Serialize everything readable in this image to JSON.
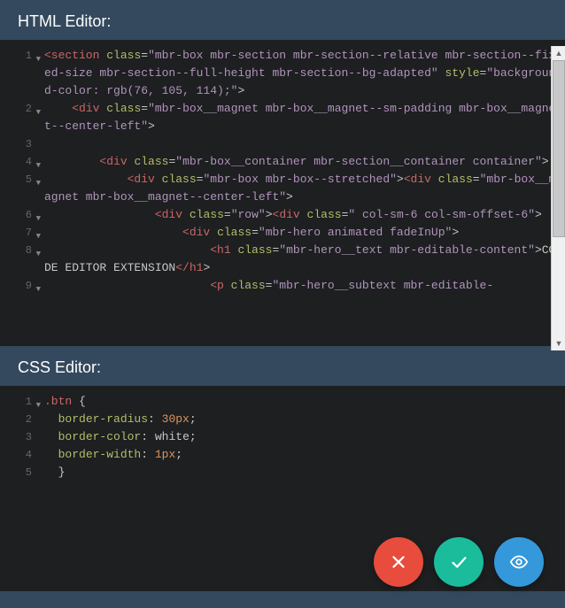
{
  "headers": {
    "html": "HTML Editor:",
    "css": "CSS Editor:"
  },
  "html_lines": [
    {
      "n": "1",
      "fold": true,
      "tokens": [
        [
          "tag",
          "<section"
        ],
        [
          "text",
          " "
        ],
        [
          "attr",
          "class"
        ],
        [
          "eq",
          "="
        ],
        [
          "str",
          "\"mbr-box mbr-section mbr-section--relative mbr-section--fixed-size mbr-section--full-height mbr-section--bg-adapted\""
        ],
        [
          "text",
          " "
        ],
        [
          "attr",
          "style"
        ],
        [
          "eq",
          "="
        ],
        [
          "str",
          "\"background-color: rgb(76, 105, 114);\""
        ],
        [
          "bracket",
          ">"
        ]
      ]
    },
    {
      "n": "2",
      "fold": true,
      "indent": 2,
      "tokens": [
        [
          "tag",
          "<div"
        ],
        [
          "text",
          " "
        ],
        [
          "attr",
          "class"
        ],
        [
          "eq",
          "="
        ],
        [
          "str",
          "\"mbr-box__magnet mbr-box__magnet--sm-padding mbr-box__magnet--center-left\""
        ],
        [
          "bracket",
          ">"
        ]
      ]
    },
    {
      "n": "3",
      "fold": false,
      "tokens": []
    },
    {
      "n": "4",
      "fold": true,
      "indent": 4,
      "tokens": [
        [
          "tag",
          "<div"
        ],
        [
          "text",
          " "
        ],
        [
          "attr",
          "class"
        ],
        [
          "eq",
          "="
        ],
        [
          "str",
          "\"mbr-box__container mbr-section__container container\""
        ],
        [
          "bracket",
          ">"
        ]
      ]
    },
    {
      "n": "5",
      "fold": true,
      "indent": 6,
      "tokens": [
        [
          "tag",
          "<div"
        ],
        [
          "text",
          " "
        ],
        [
          "attr",
          "class"
        ],
        [
          "eq",
          "="
        ],
        [
          "str",
          "\"mbr-box mbr-box--stretched\""
        ],
        [
          "bracket",
          ">"
        ],
        [
          "tag",
          "<div"
        ],
        [
          "text",
          " "
        ],
        [
          "attr",
          "class"
        ],
        [
          "eq",
          "="
        ],
        [
          "str",
          "\"mbr-box__magnet mbr-box__magnet--center-left\""
        ],
        [
          "bracket",
          ">"
        ]
      ]
    },
    {
      "n": "6",
      "fold": true,
      "indent": 8,
      "tokens": [
        [
          "tag",
          "<div"
        ],
        [
          "text",
          " "
        ],
        [
          "attr",
          "class"
        ],
        [
          "eq",
          "="
        ],
        [
          "str",
          "\"row\""
        ],
        [
          "bracket",
          ">"
        ],
        [
          "tag",
          "<div"
        ],
        [
          "text",
          " "
        ],
        [
          "attr",
          "class"
        ],
        [
          "eq",
          "="
        ],
        [
          "str",
          "\" col-sm-6 col-sm-offset-6\""
        ],
        [
          "bracket",
          ">"
        ]
      ]
    },
    {
      "n": "7",
      "fold": true,
      "indent": 10,
      "tokens": [
        [
          "tag",
          "<div"
        ],
        [
          "text",
          " "
        ],
        [
          "attr",
          "class"
        ],
        [
          "eq",
          "="
        ],
        [
          "str",
          "\"mbr-hero animated fadeInUp\""
        ],
        [
          "bracket",
          ">"
        ]
      ]
    },
    {
      "n": "8",
      "fold": true,
      "indent": 12,
      "tokens": [
        [
          "tag",
          "<h1"
        ],
        [
          "text",
          " "
        ],
        [
          "attr",
          "class"
        ],
        [
          "eq",
          "="
        ],
        [
          "str",
          "\"mbr-hero__text mbr-editable-content\""
        ],
        [
          "bracket",
          ">"
        ],
        [
          "text",
          "CODE EDITOR EXTENSION"
        ],
        [
          "tag",
          "</h1"
        ],
        [
          "bracket",
          ">"
        ]
      ]
    },
    {
      "n": "9",
      "fold": true,
      "indent": 12,
      "tokens": [
        [
          "tag",
          "<p"
        ],
        [
          "text",
          " "
        ],
        [
          "attr",
          "class"
        ],
        [
          "eq",
          "="
        ],
        [
          "str",
          "\"mbr-hero__subtext mbr-editable-"
        ]
      ]
    }
  ],
  "css_lines": [
    {
      "n": "1",
      "fold": true,
      "tokens": [
        [
          "sel",
          ".btn"
        ],
        [
          "text",
          " "
        ],
        [
          "punct",
          "{"
        ]
      ]
    },
    {
      "n": "2",
      "fold": false,
      "indent": 1,
      "tokens": [
        [
          "prop",
          "border-radius"
        ],
        [
          "punct",
          ":"
        ],
        [
          "text",
          " "
        ],
        [
          "num",
          "30px"
        ],
        [
          "punct",
          ";"
        ]
      ]
    },
    {
      "n": "3",
      "fold": false,
      "indent": 1,
      "tokens": [
        [
          "prop",
          "border-color"
        ],
        [
          "punct",
          ":"
        ],
        [
          "text",
          " "
        ],
        [
          "val",
          "white"
        ],
        [
          "punct",
          ";"
        ]
      ]
    },
    {
      "n": "4",
      "fold": false,
      "indent": 1,
      "tokens": [
        [
          "prop",
          "border-width"
        ],
        [
          "punct",
          ":"
        ],
        [
          "text",
          " "
        ],
        [
          "num",
          "1px"
        ],
        [
          "punct",
          ";"
        ]
      ]
    },
    {
      "n": "5",
      "fold": false,
      "indent": 1,
      "tokens": [
        [
          "punct",
          "}"
        ]
      ]
    }
  ],
  "buttons": {
    "cancel": "cancel",
    "save": "save",
    "preview": "preview"
  }
}
